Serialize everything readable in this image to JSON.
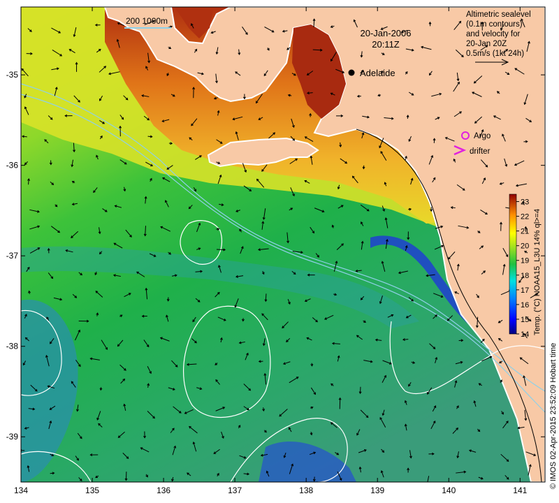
{
  "map": {
    "date": "20-Jan-2006",
    "time": "20:11Z",
    "scale_label": "200  1000m",
    "city": "Adelaide",
    "legend_lines": [
      "Altimetric sealevel",
      "(0.1m contours)",
      "and velocity for",
      "20-Jan 20Z",
      "0.5m/s (1kt 24h)"
    ],
    "argo_label": "Argo",
    "drifter_label": "drifter",
    "colorbar_label": "Temp. (°C) NOAA15_L3U 14% ql>=4",
    "colorbar_ticks": [
      "14",
      "15",
      "16",
      "17",
      "18",
      "19",
      "20",
      "21",
      "22",
      "23"
    ],
    "colorbar_range": [
      14,
      23.5
    ],
    "lon_ticks": [
      "134",
      "135",
      "136",
      "137",
      "138",
      "139",
      "140",
      "141"
    ],
    "lat_ticks": [
      "-35",
      "-36",
      "-37",
      "-38",
      "-39"
    ],
    "lon_range": [
      134,
      141.35
    ],
    "lat_range": [
      -39.5,
      -34.25
    ],
    "credit": "© IMOS 02-Apr-2015 23:52:09 Hobart time",
    "colors": {
      "land": "#f8c9a6",
      "argo": "#e020e0",
      "drifter": "#e020e0",
      "contour": "#ffffff",
      "isobath": "#8fd0e8"
    }
  }
}
